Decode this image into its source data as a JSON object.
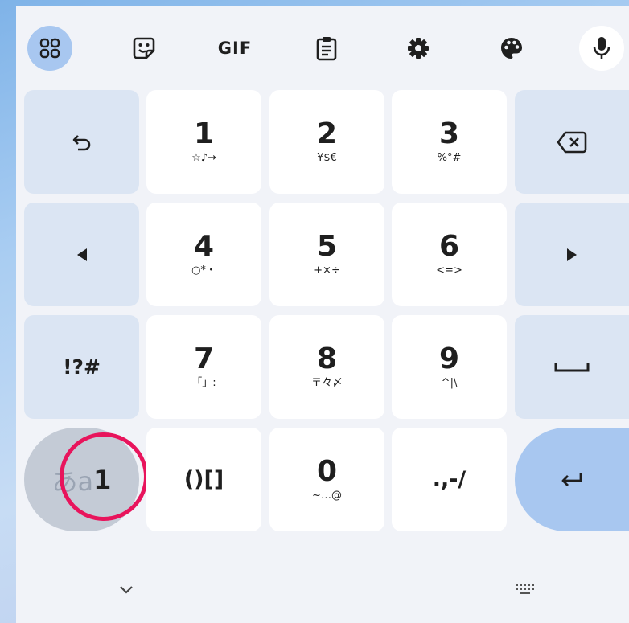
{
  "toolbar": {
    "gif_label": "GIF",
    "icons": [
      "apps-icon",
      "sticker-icon",
      "gif-icon",
      "clipboard-icon",
      "settings-icon",
      "theme-icon",
      "mic-icon"
    ]
  },
  "keys": {
    "k1": {
      "main": "1",
      "sub": "☆♪→"
    },
    "k2": {
      "main": "2",
      "sub": "¥$€"
    },
    "k3": {
      "main": "3",
      "sub": "%°#"
    },
    "k4": {
      "main": "4",
      "sub": "○*・"
    },
    "k5": {
      "main": "5",
      "sub": "+×÷"
    },
    "k6": {
      "main": "6",
      "sub": "<=>"
    },
    "k7": {
      "main": "7",
      "sub": "「」:"
    },
    "k8": {
      "main": "8",
      "sub": "〒々〆"
    },
    "k9": {
      "main": "9",
      "sub": "^|\\"
    },
    "k0": {
      "main": "0",
      "sub": "~…@"
    },
    "symbols": "!?#",
    "brackets": "()[]",
    "punct": ".,-/",
    "mode_kana": "あa",
    "mode_num": "1"
  },
  "colors": {
    "accent": "#a8c7f0",
    "function_key": "#dbe5f3",
    "highlight_ring": "#e8145c"
  }
}
